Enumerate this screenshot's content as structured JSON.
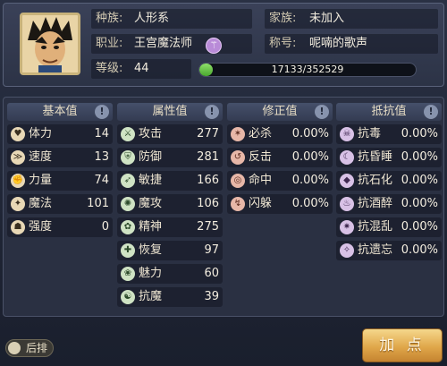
{
  "profile": {
    "race_label": "种族:",
    "race_value": "人形系",
    "family_label": "家族:",
    "family_value": "未加入",
    "job_label": "职业:",
    "job_value": "王宫魔法师",
    "title_label": "称号:",
    "title_value": "呢喃的歌声",
    "level_label": "等级:",
    "level_value": "44",
    "exp_current": 17133,
    "exp_max": 352529,
    "exp_text": "17133/352529",
    "exp_fraction": 0.0486
  },
  "columns": {
    "base": {
      "header": "基本值",
      "items": [
        {
          "name": "体力",
          "value": "14",
          "icon": "heart-icon"
        },
        {
          "name": "速度",
          "value": "13",
          "icon": "speed-icon"
        },
        {
          "name": "力量",
          "value": "74",
          "icon": "strength-icon"
        },
        {
          "name": "魔法",
          "value": "101",
          "icon": "magic-icon"
        },
        {
          "name": "强度",
          "value": "0",
          "icon": "endurance-icon"
        }
      ]
    },
    "attr": {
      "header": "属性值",
      "items": [
        {
          "name": "攻击",
          "value": "277",
          "icon": "attack-icon"
        },
        {
          "name": "防御",
          "value": "281",
          "icon": "defense-icon"
        },
        {
          "name": "敏捷",
          "value": "166",
          "icon": "agility-icon"
        },
        {
          "name": "魔攻",
          "value": "106",
          "icon": "magic-attack-icon"
        },
        {
          "name": "精神",
          "value": "275",
          "icon": "spirit-icon"
        },
        {
          "name": "恢复",
          "value": "97",
          "icon": "recovery-icon"
        },
        {
          "name": "魅力",
          "value": "60",
          "icon": "charm-icon"
        },
        {
          "name": "抗魔",
          "value": "39",
          "icon": "magic-resist-icon"
        }
      ]
    },
    "mod": {
      "header": "修正值",
      "items": [
        {
          "name": "必杀",
          "value": "0.00%",
          "icon": "critical-icon"
        },
        {
          "name": "反击",
          "value": "0.00%",
          "icon": "counter-icon"
        },
        {
          "name": "命中",
          "value": "0.00%",
          "icon": "hit-icon"
        },
        {
          "name": "闪躲",
          "value": "0.00%",
          "icon": "dodge-icon"
        }
      ]
    },
    "resist": {
      "header": "抵抗值",
      "items": [
        {
          "name": "抗毒",
          "value": "0.00%",
          "icon": "poison-resist-icon"
        },
        {
          "name": "抗昏睡",
          "value": "0.00%",
          "icon": "sleep-resist-icon"
        },
        {
          "name": "抗石化",
          "value": "0.00%",
          "icon": "petrify-resist-icon"
        },
        {
          "name": "抗酒醉",
          "value": "0.00%",
          "icon": "drunk-resist-icon"
        },
        {
          "name": "抗混乱",
          "value": "0.00%",
          "icon": "confusion-resist-icon"
        },
        {
          "name": "抗遗忘",
          "value": "0.00%",
          "icon": "amnesia-resist-icon"
        }
      ]
    }
  },
  "bottom": {
    "toggle_label": "后排",
    "add_points_label": "加 点"
  }
}
